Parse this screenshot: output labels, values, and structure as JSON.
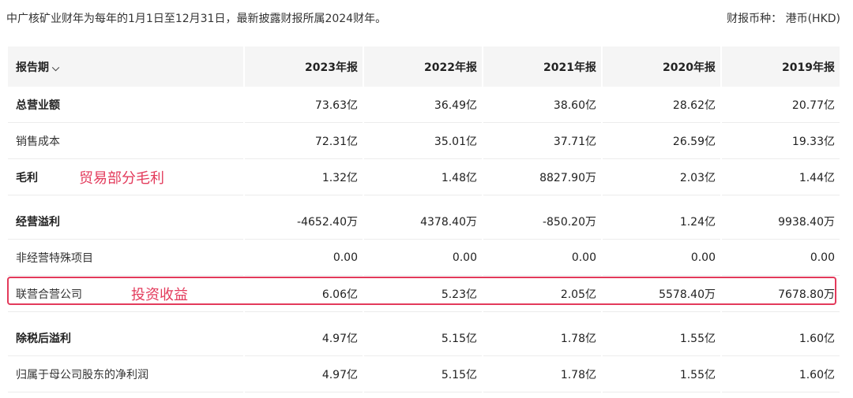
{
  "note": "中广核矿业财年为每年的1月1日至12月31日，最新披露财报所属2024财年。",
  "currency": "财报币种：  港币(HKD)",
  "table": {
    "period_label": "报告期",
    "period_chevron": "chevron-down-icon",
    "headers": [
      "2023年报",
      "2022年报",
      "2021年报",
      "2020年报",
      "2019年报"
    ],
    "rows": [
      {
        "label": "总营业额",
        "values": [
          "73.63亿",
          "36.49亿",
          "38.60亿",
          "28.62亿",
          "20.77亿"
        ]
      },
      {
        "label": "销售成本",
        "values": [
          "72.31亿",
          "35.01亿",
          "37.71亿",
          "26.59亿",
          "19.33亿"
        ]
      },
      {
        "label": "毛利",
        "values": [
          "1.32亿",
          "1.48亿",
          "8827.90万",
          "2.03亿",
          "1.44亿"
        ]
      },
      {
        "label": "经营溢利",
        "values": [
          "-4652.40万",
          "4378.40万",
          "-850.20万",
          "1.24亿",
          "9938.40万"
        ]
      },
      {
        "label": "非经营特殊项目",
        "values": [
          "0.00",
          "0.00",
          "0.00",
          "0.00",
          "0.00"
        ]
      },
      {
        "label": "联营合营公司",
        "values": [
          "6.06亿",
          "5.23亿",
          "2.05亿",
          "5578.40万",
          "7678.80万"
        ]
      },
      {
        "label": "除税后溢利",
        "values": [
          "4.97亿",
          "5.15亿",
          "1.78亿",
          "1.55亿",
          "1.60亿"
        ]
      },
      {
        "label": "归属于母公司股东的净利润",
        "values": [
          "4.97亿",
          "5.15亿",
          "1.78亿",
          "1.55亿",
          "1.60亿"
        ]
      }
    ]
  },
  "annotations": {
    "trade_margin": "贸易部分毛利",
    "investment_income": "投资收益",
    "color": "#e33a5b"
  }
}
